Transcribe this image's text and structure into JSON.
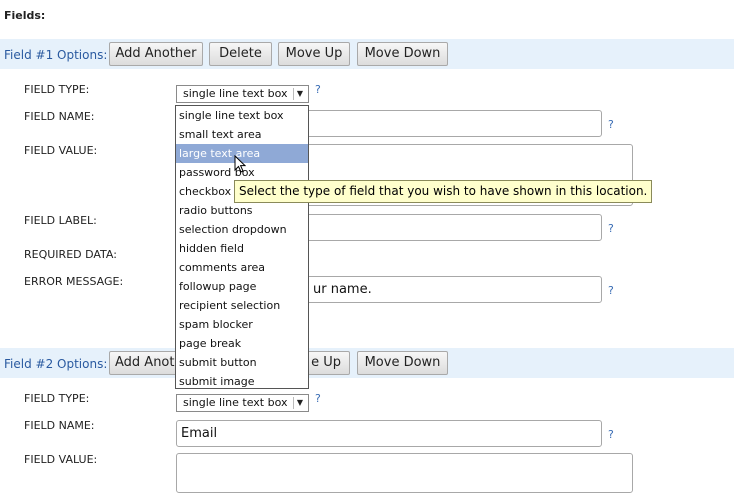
{
  "section_title": "Fields:",
  "field1": {
    "band_label": "Field #1 Options:",
    "buttons": [
      "Add Another",
      "Delete",
      "Move Up",
      "Move Down"
    ],
    "labels": {
      "type": "FIELD TYPE:",
      "name": "FIELD NAME:",
      "value": "FIELD VALUE:",
      "label": "FIELD LABEL:",
      "required": "REQUIRED DATA:",
      "error": "ERROR MESSAGE:"
    },
    "type_value": "single line text box",
    "error_value": "ur name.",
    "help": "?"
  },
  "dropdown": {
    "options": [
      "single line text box",
      "small text area",
      "large text area",
      "password box",
      "checkbox",
      "radio buttons",
      "selection dropdown",
      "hidden field",
      "comments area",
      "followup page",
      "recipient selection",
      "spam blocker",
      "page break",
      "submit button",
      "submit image"
    ],
    "highlighted": "large text area"
  },
  "tooltip": "Select the type of field that you wish to have shown in this location.",
  "field2": {
    "band_label": "Field #2 Options:",
    "buttons": [
      "Add Anoth",
      "e Up",
      "Move Down"
    ],
    "labels": {
      "type": "FIELD TYPE:",
      "name": "FIELD NAME:",
      "value": "FIELD VALUE:"
    },
    "type_value": "single line text box",
    "name_value": "Email",
    "help": "?"
  }
}
